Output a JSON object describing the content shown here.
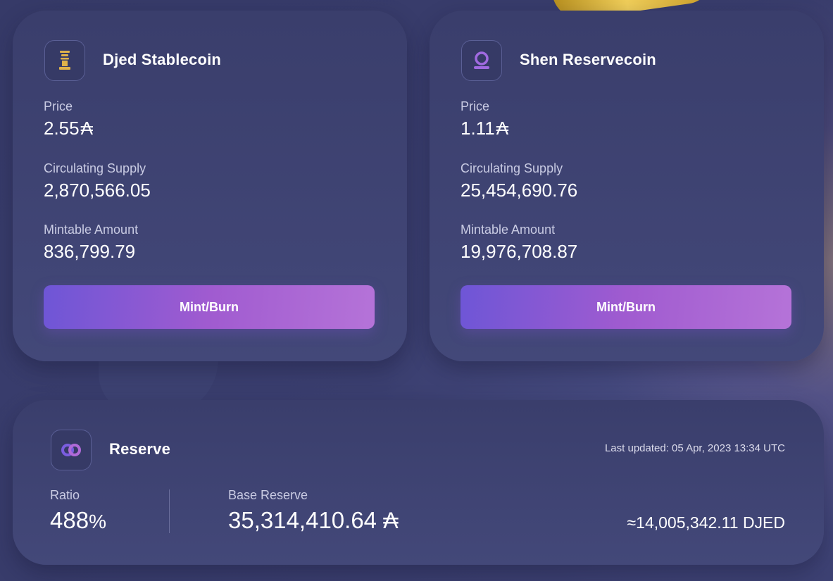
{
  "djed": {
    "title": "Djed Stablecoin",
    "icon": "djed-pillar-icon",
    "price_label": "Price",
    "price_value": "2.55",
    "price_unit": "₳",
    "supply_label": "Circulating Supply",
    "supply_value": "2,870,566.05",
    "mintable_label": "Mintable Amount",
    "mintable_value": "836,799.79",
    "button_label": "Mint/Burn"
  },
  "shen": {
    "title": "Shen Reservecoin",
    "icon": "shen-ring-icon",
    "price_label": "Price",
    "price_value": "1.11",
    "price_unit": "₳",
    "supply_label": "Circulating Supply",
    "supply_value": "25,454,690.76",
    "mintable_label": "Mintable Amount",
    "mintable_value": "19,976,708.87",
    "button_label": "Mint/Burn"
  },
  "reserve": {
    "title": "Reserve",
    "icon": "reserve-cycle-icon",
    "last_updated": "Last updated: 05 Apr, 2023 13:34 UTC",
    "ratio_label": "Ratio",
    "ratio_value": "488",
    "ratio_unit": "%",
    "base_label": "Base Reserve",
    "base_value": "35,314,410.64",
    "base_unit": "₳",
    "approx_value": "≈14,005,342.11 DJED"
  },
  "colors": {
    "accent_start": "#6e56d6",
    "accent_end": "#b573d8",
    "card_bg": "#3a3e6c",
    "djed_icon": "#e0b24a",
    "shen_icon": "#a06ae0"
  }
}
